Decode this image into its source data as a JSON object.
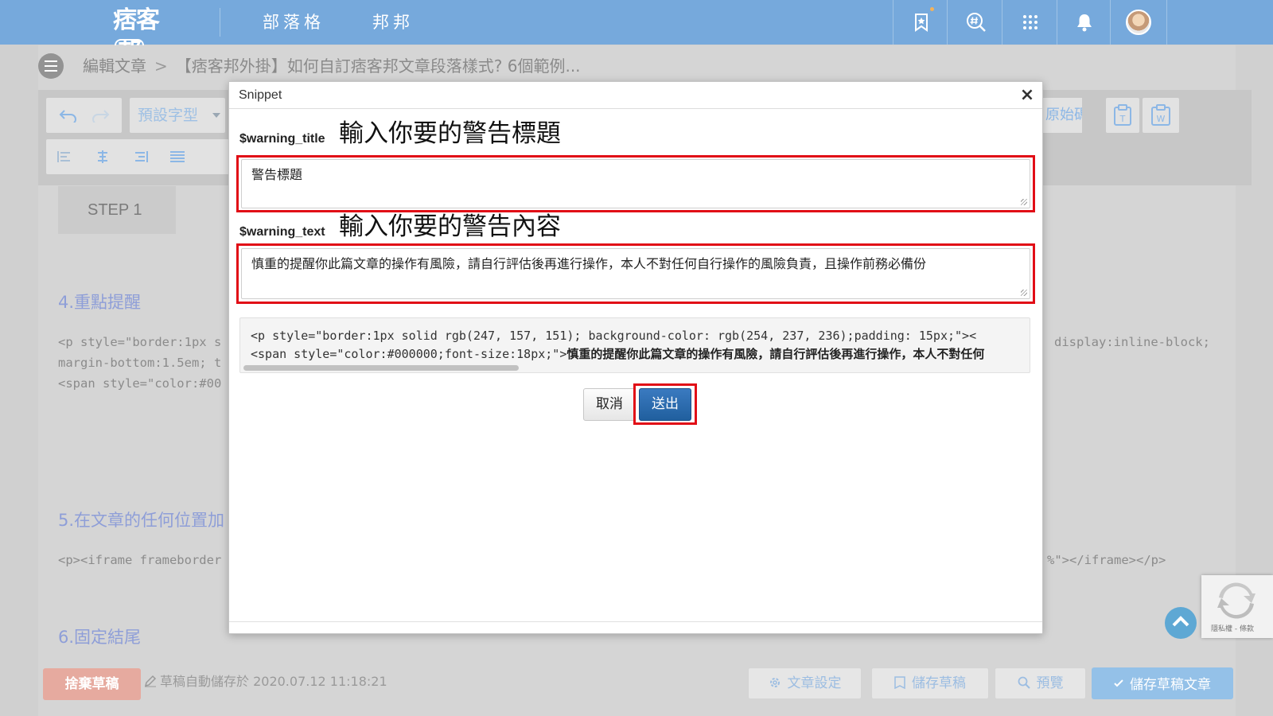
{
  "header": {
    "logo_text": "痞客",
    "logo_boxed": "邦",
    "nav": [
      {
        "label": "部落格"
      },
      {
        "label": "邦邦"
      }
    ]
  },
  "breadcrumb": {
    "section": "編輯文章",
    "separator": ">",
    "article_title": "【痞客邦外掛】如何自訂痞客邦文章段落樣式? 6個範例..."
  },
  "toolbar": {
    "font_select": "預設字型",
    "source_label": "原始碼"
  },
  "editor": {
    "step_label": "STEP 1",
    "sections": [
      {
        "heading": "4.重點提醒"
      },
      {
        "heading": "5.在文章的任何位置加"
      },
      {
        "heading": "6.固定結尾"
      }
    ],
    "code_lines": [
      "<p style=\"border:1px s",
      "margin-bottom:1.5em; t",
      "<span style=\"color:#00",
      "<p><iframe frameborder"
    ],
    "code_right": [
      "display:inline-block;",
      "%\"></iframe></p>"
    ]
  },
  "modal": {
    "title": "Snippet",
    "close_label": "×",
    "fields": [
      {
        "label": "$warning_title",
        "note": "輸入你要的警告標題",
        "value": "警告標題"
      },
      {
        "label": "$warning_text",
        "note": "輸入你要的警告內容",
        "value": "慎重的提醒你此篇文章的操作有風險，請自行評估後再進行操作，本人不對任何自行操作的風險負責，且操作前務必備份"
      }
    ],
    "preview_line1": "<p style=\"border:1px solid rgb(247, 157, 151); background-color: rgb(254, 237, 236);padding: 15px;\"><",
    "preview_line2_code": "<span style=\"color:#000000;font-size:18px;\">",
    "preview_line2_text": "慎重的提醒你此篇文章的操作有風險，請自行評估後再進行操作，本人不對任何",
    "cancel_label": "取消",
    "submit_label": "送出"
  },
  "footer": {
    "discard_label": "捨棄草稿",
    "autosave_text": "草稿自動儲存於 2020.07.12 11:18:21",
    "settings_label": "文章設定",
    "save_draft_label": "儲存草稿",
    "preview_label": "預覽",
    "save_article_label": "儲存草稿文章"
  },
  "recaptcha": {
    "text": "隱私權 - 條款"
  },
  "colors": {
    "header_bg": "#76a9dc",
    "highlight_red": "#e10d16",
    "submit_blue": "#2c6aac",
    "discard_red": "#e6aa9f",
    "heading_purple": "#8e9ed8"
  },
  "icons": [
    "bookmark-star-icon",
    "hashtag-search-icon",
    "grid-apps-icon",
    "bell-icon",
    "undo-icon",
    "redo-icon",
    "align-left-icon",
    "align-center-icon",
    "align-right-icon",
    "align-justify-icon",
    "paste-text-icon",
    "paste-word-icon",
    "gear-icon",
    "file-icon",
    "search-icon",
    "check-icon",
    "pencil-icon",
    "chevron-up-icon",
    "menu-icon",
    "close-icon"
  ]
}
